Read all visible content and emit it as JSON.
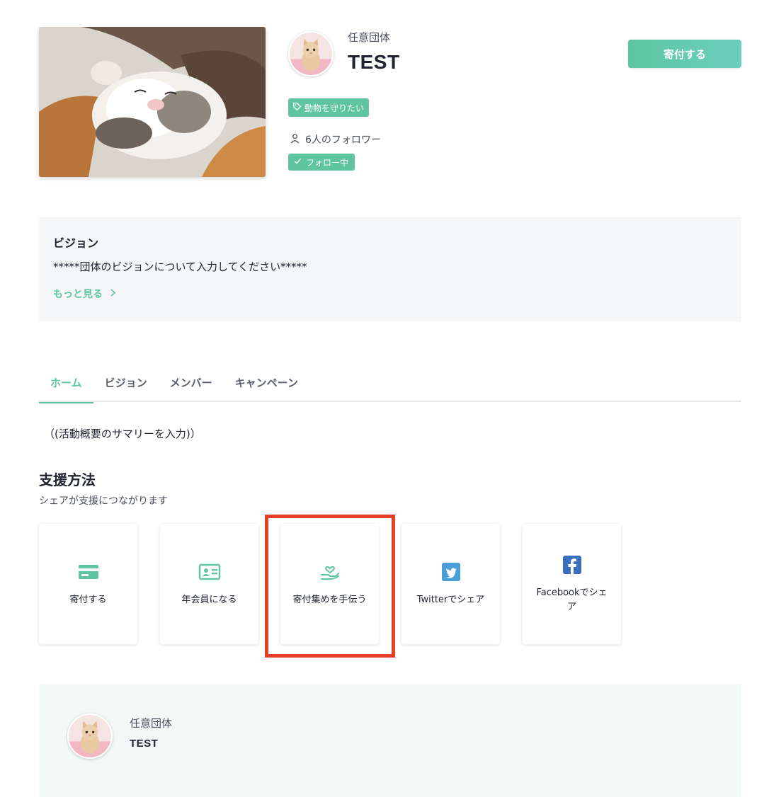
{
  "header": {
    "org_type": "任意団体",
    "org_name": "TEST",
    "tag_label": "動物を守りたい",
    "followers_text": "6人のフォロワー",
    "follow_status": "フォロー中",
    "donate_button": "寄付する"
  },
  "vision": {
    "title": "ビジョン",
    "text": "*****団体のビジョンについて入力してください*****",
    "more_label": "もっと見る"
  },
  "tabs": [
    {
      "label": "ホーム",
      "active": true
    },
    {
      "label": "ビジョン",
      "active": false
    },
    {
      "label": "メンバー",
      "active": false
    },
    {
      "label": "キャンペーン",
      "active": false
    }
  ],
  "summary": "（(活動概要のサマリーを入力)）",
  "support": {
    "title": "支援方法",
    "subtitle": "シェアが支援につながります",
    "cards": [
      {
        "label": "寄付する",
        "icon": "credit-card-icon"
      },
      {
        "label": "年会員になる",
        "icon": "id-card-icon"
      },
      {
        "label": "寄付集めを手伝う",
        "icon": "hand-heart-icon",
        "highlighted": true
      },
      {
        "label": "Twitterでシェア",
        "icon": "twitter-icon"
      },
      {
        "label": "Facebookでシェア",
        "icon": "facebook-icon"
      }
    ]
  },
  "footer": {
    "org_type": "任意団体",
    "org_name": "TEST"
  },
  "colors": {
    "accent": "#5ec5a0",
    "highlight": "#e6402a",
    "twitter": "#4a9fd8",
    "facebook": "#3b6fc0"
  }
}
